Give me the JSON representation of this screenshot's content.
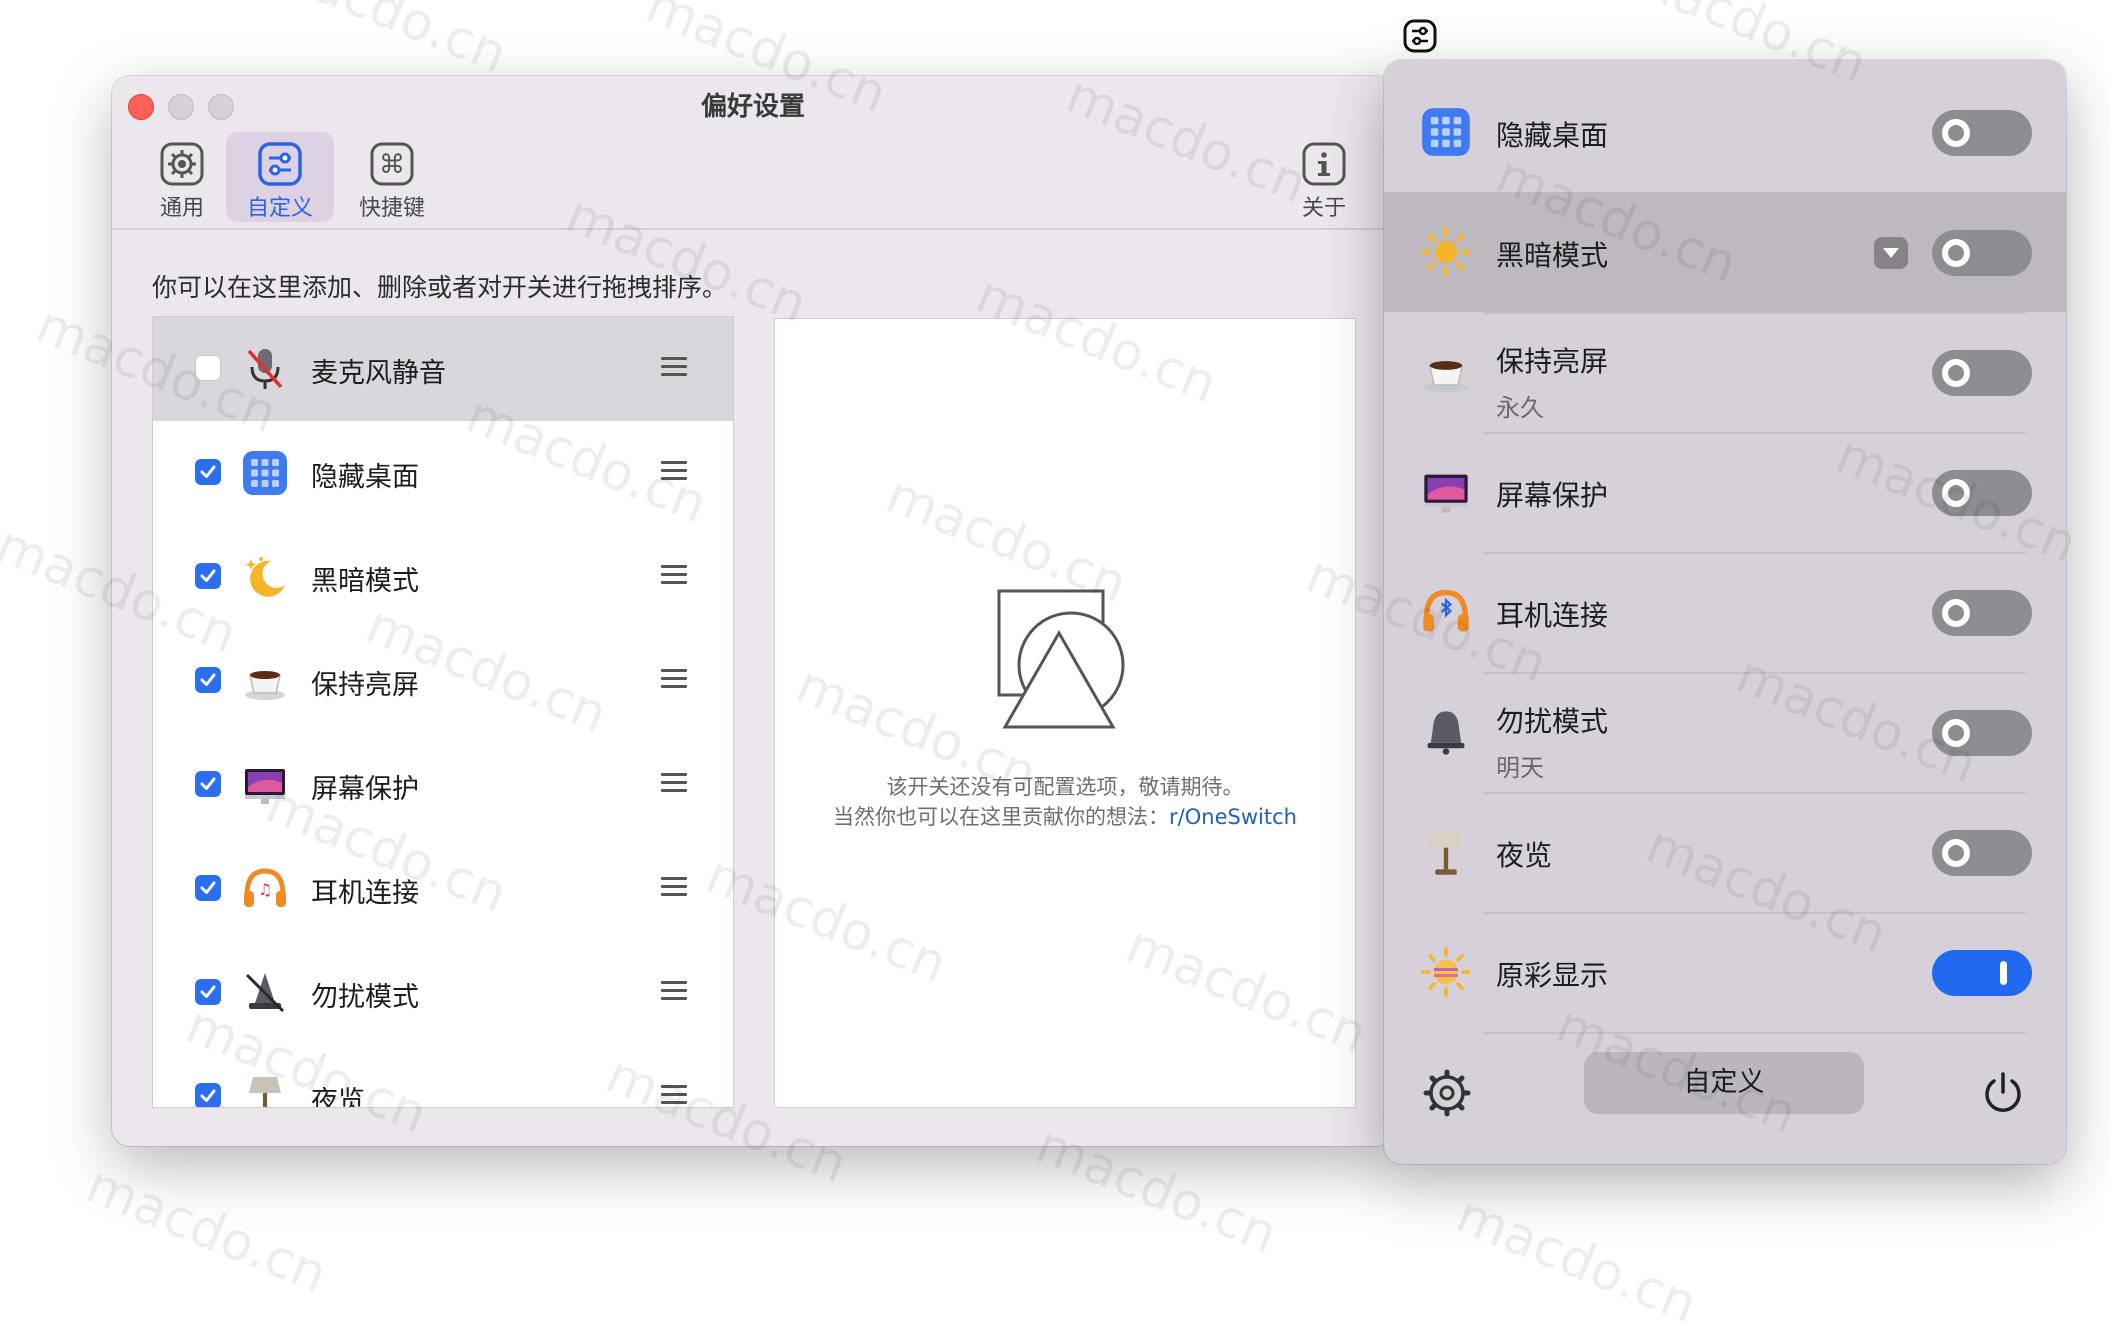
{
  "window": {
    "title": "偏好设置",
    "toolbar": [
      {
        "label": "通用",
        "icon": "gear-icon"
      },
      {
        "label": "自定义",
        "icon": "sliders-icon",
        "active": true
      },
      {
        "label": "快捷键",
        "icon": "command-icon"
      },
      {
        "label": "关于",
        "icon": "info-icon"
      }
    ],
    "description": "你可以在这里添加、删除或者对开关进行拖拽排序。",
    "list_items": [
      {
        "label": "麦克风静音",
        "checked": false,
        "icon": "microphone-mute-icon",
        "selected": true
      },
      {
        "label": "隐藏桌面",
        "checked": true,
        "icon": "grid-icon"
      },
      {
        "label": "黑暗模式",
        "checked": true,
        "icon": "moon-icon"
      },
      {
        "label": "保持亮屏",
        "checked": true,
        "icon": "coffee-cup-icon"
      },
      {
        "label": "屏幕保护",
        "checked": true,
        "icon": "monitor-icon"
      },
      {
        "label": "耳机连接",
        "checked": true,
        "icon": "headphones-icon"
      },
      {
        "label": "勿扰模式",
        "checked": true,
        "icon": "bell-icon"
      },
      {
        "label": "夜览",
        "checked": true,
        "icon": "lamp-icon"
      }
    ],
    "detail": {
      "placeholder_line1": "该开关还没有可配置选项，敬请期待。",
      "placeholder_line2_prefix": "当然你也可以在这里贡献你的想法：",
      "placeholder_link": "r/OneSwitch"
    }
  },
  "menubar": {
    "icon": "oneswitch-menubar-icon"
  },
  "panel": {
    "items": [
      {
        "title": "隐藏桌面",
        "subtitle": "",
        "icon": "grid-icon",
        "on": false
      },
      {
        "title": "黑暗模式",
        "subtitle": "",
        "icon": "sun-icon",
        "on": false,
        "highlighted": true,
        "has_dropdown": true
      },
      {
        "title": "保持亮屏",
        "subtitle": "永久",
        "icon": "coffee-cup-icon",
        "on": false
      },
      {
        "title": "屏幕保护",
        "subtitle": "",
        "icon": "monitor-icon",
        "on": false
      },
      {
        "title": "耳机连接",
        "subtitle": "",
        "icon": "headphones-bluetooth-icon",
        "on": false
      },
      {
        "title": "勿扰模式",
        "subtitle": "明天",
        "icon": "bell-icon",
        "on": false
      },
      {
        "title": "夜览",
        "subtitle": "",
        "icon": "lamp-icon",
        "on": false
      },
      {
        "title": "原彩显示",
        "subtitle": "",
        "icon": "true-tone-icon",
        "on": true
      }
    ],
    "footer": {
      "customize_label": "自定义",
      "left_icon": "gear-icon",
      "right_icon": "power-icon"
    }
  },
  "colors": {
    "accent": "#2b6ff0",
    "close": "#fe5f57",
    "link": "#1f5fbf"
  }
}
